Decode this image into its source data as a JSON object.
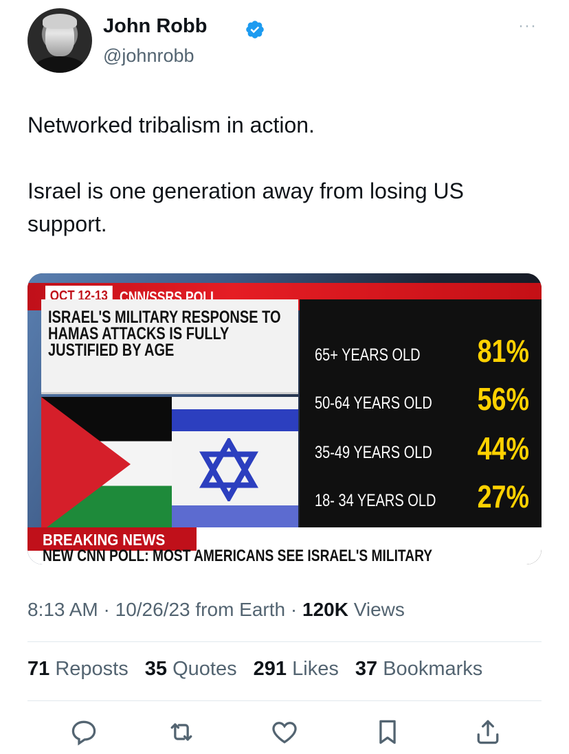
{
  "author": {
    "name": "John Robb",
    "handle": "@johnrobb",
    "verified_color": "#1d9bf0"
  },
  "more_label": "···",
  "tweet": {
    "lines": [
      "Networked tribalism in action.",
      "Israel is one generation away from losing US support."
    ]
  },
  "media": {
    "poll_date": "OCT 12-13",
    "poll_source": "CNN/SSRS POLL",
    "title": "ISRAEL'S MILITARY RESPONSE TO HAMAS ATTACKS IS FULLY JUSTIFIED BY AGE",
    "stats": [
      {
        "label": "65+ YEARS OLD",
        "value": "81%"
      },
      {
        "label": "50-64 YEARS OLD",
        "value": "56%"
      },
      {
        "label": "35-49 YEARS OLD",
        "value": "44%"
      },
      {
        "label": "18- 34 YEARS OLD",
        "value": "27%"
      }
    ],
    "breaking": "BREAKING NEWS",
    "ticker": "NEW CNN POLL: MOST AMERICANS SEE ISRAEL'S MILITARY",
    "colors": {
      "red": "#c0101a",
      "yellow": "#ffd100",
      "blue": "#2c3fbf"
    }
  },
  "meta": {
    "time": "8:13 AM",
    "date": "10/26/23",
    "source": "from Earth",
    "views_count": "120K",
    "views_label": "Views"
  },
  "counts": [
    {
      "count": "71",
      "label": "Reposts"
    },
    {
      "count": "35",
      "label": "Quotes"
    },
    {
      "count": "291",
      "label": "Likes"
    },
    {
      "count": "37",
      "label": "Bookmarks"
    }
  ],
  "actions": [
    "reply-icon",
    "repost-icon",
    "like-icon",
    "bookmark-icon",
    "share-icon"
  ],
  "action_color": "#536471"
}
